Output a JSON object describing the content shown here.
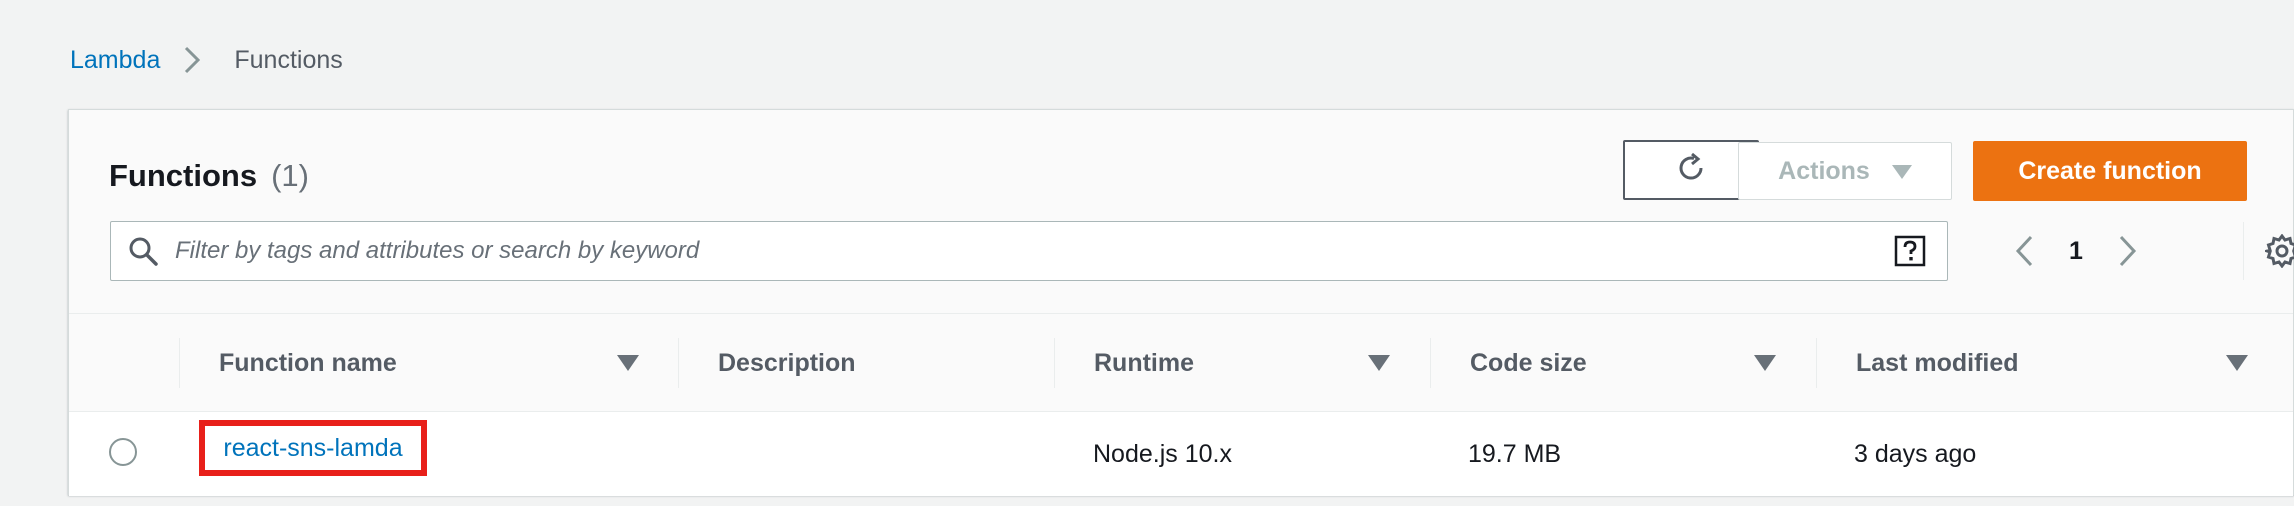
{
  "breadcrumb": {
    "root": "Lambda",
    "current": "Functions"
  },
  "panel": {
    "title": "Functions",
    "count": "(1)",
    "actions_label": "Actions",
    "create_label": "Create function"
  },
  "search": {
    "placeholder": "Filter by tags and attributes or search by keyword",
    "value": ""
  },
  "pagination": {
    "current_page": "1"
  },
  "table": {
    "columns": [
      "Function name",
      "Description",
      "Runtime",
      "Code size",
      "Last modified"
    ],
    "rows": [
      {
        "function_name": "react-sns-lamda",
        "description": "",
        "runtime": "Node.js 10.x",
        "code_size": "19.7 MB",
        "last_modified": "3 days ago"
      }
    ]
  },
  "colors": {
    "link": "#0073bb",
    "primary_button": "#ec7211",
    "highlight_box": "#e8201a"
  },
  "icons": [
    "chevron-right-icon",
    "refresh-icon",
    "caret-down-icon",
    "search-icon",
    "help-icon",
    "chevron-left-icon",
    "settings-icon",
    "sort-down-icon",
    "radio-icon"
  ]
}
